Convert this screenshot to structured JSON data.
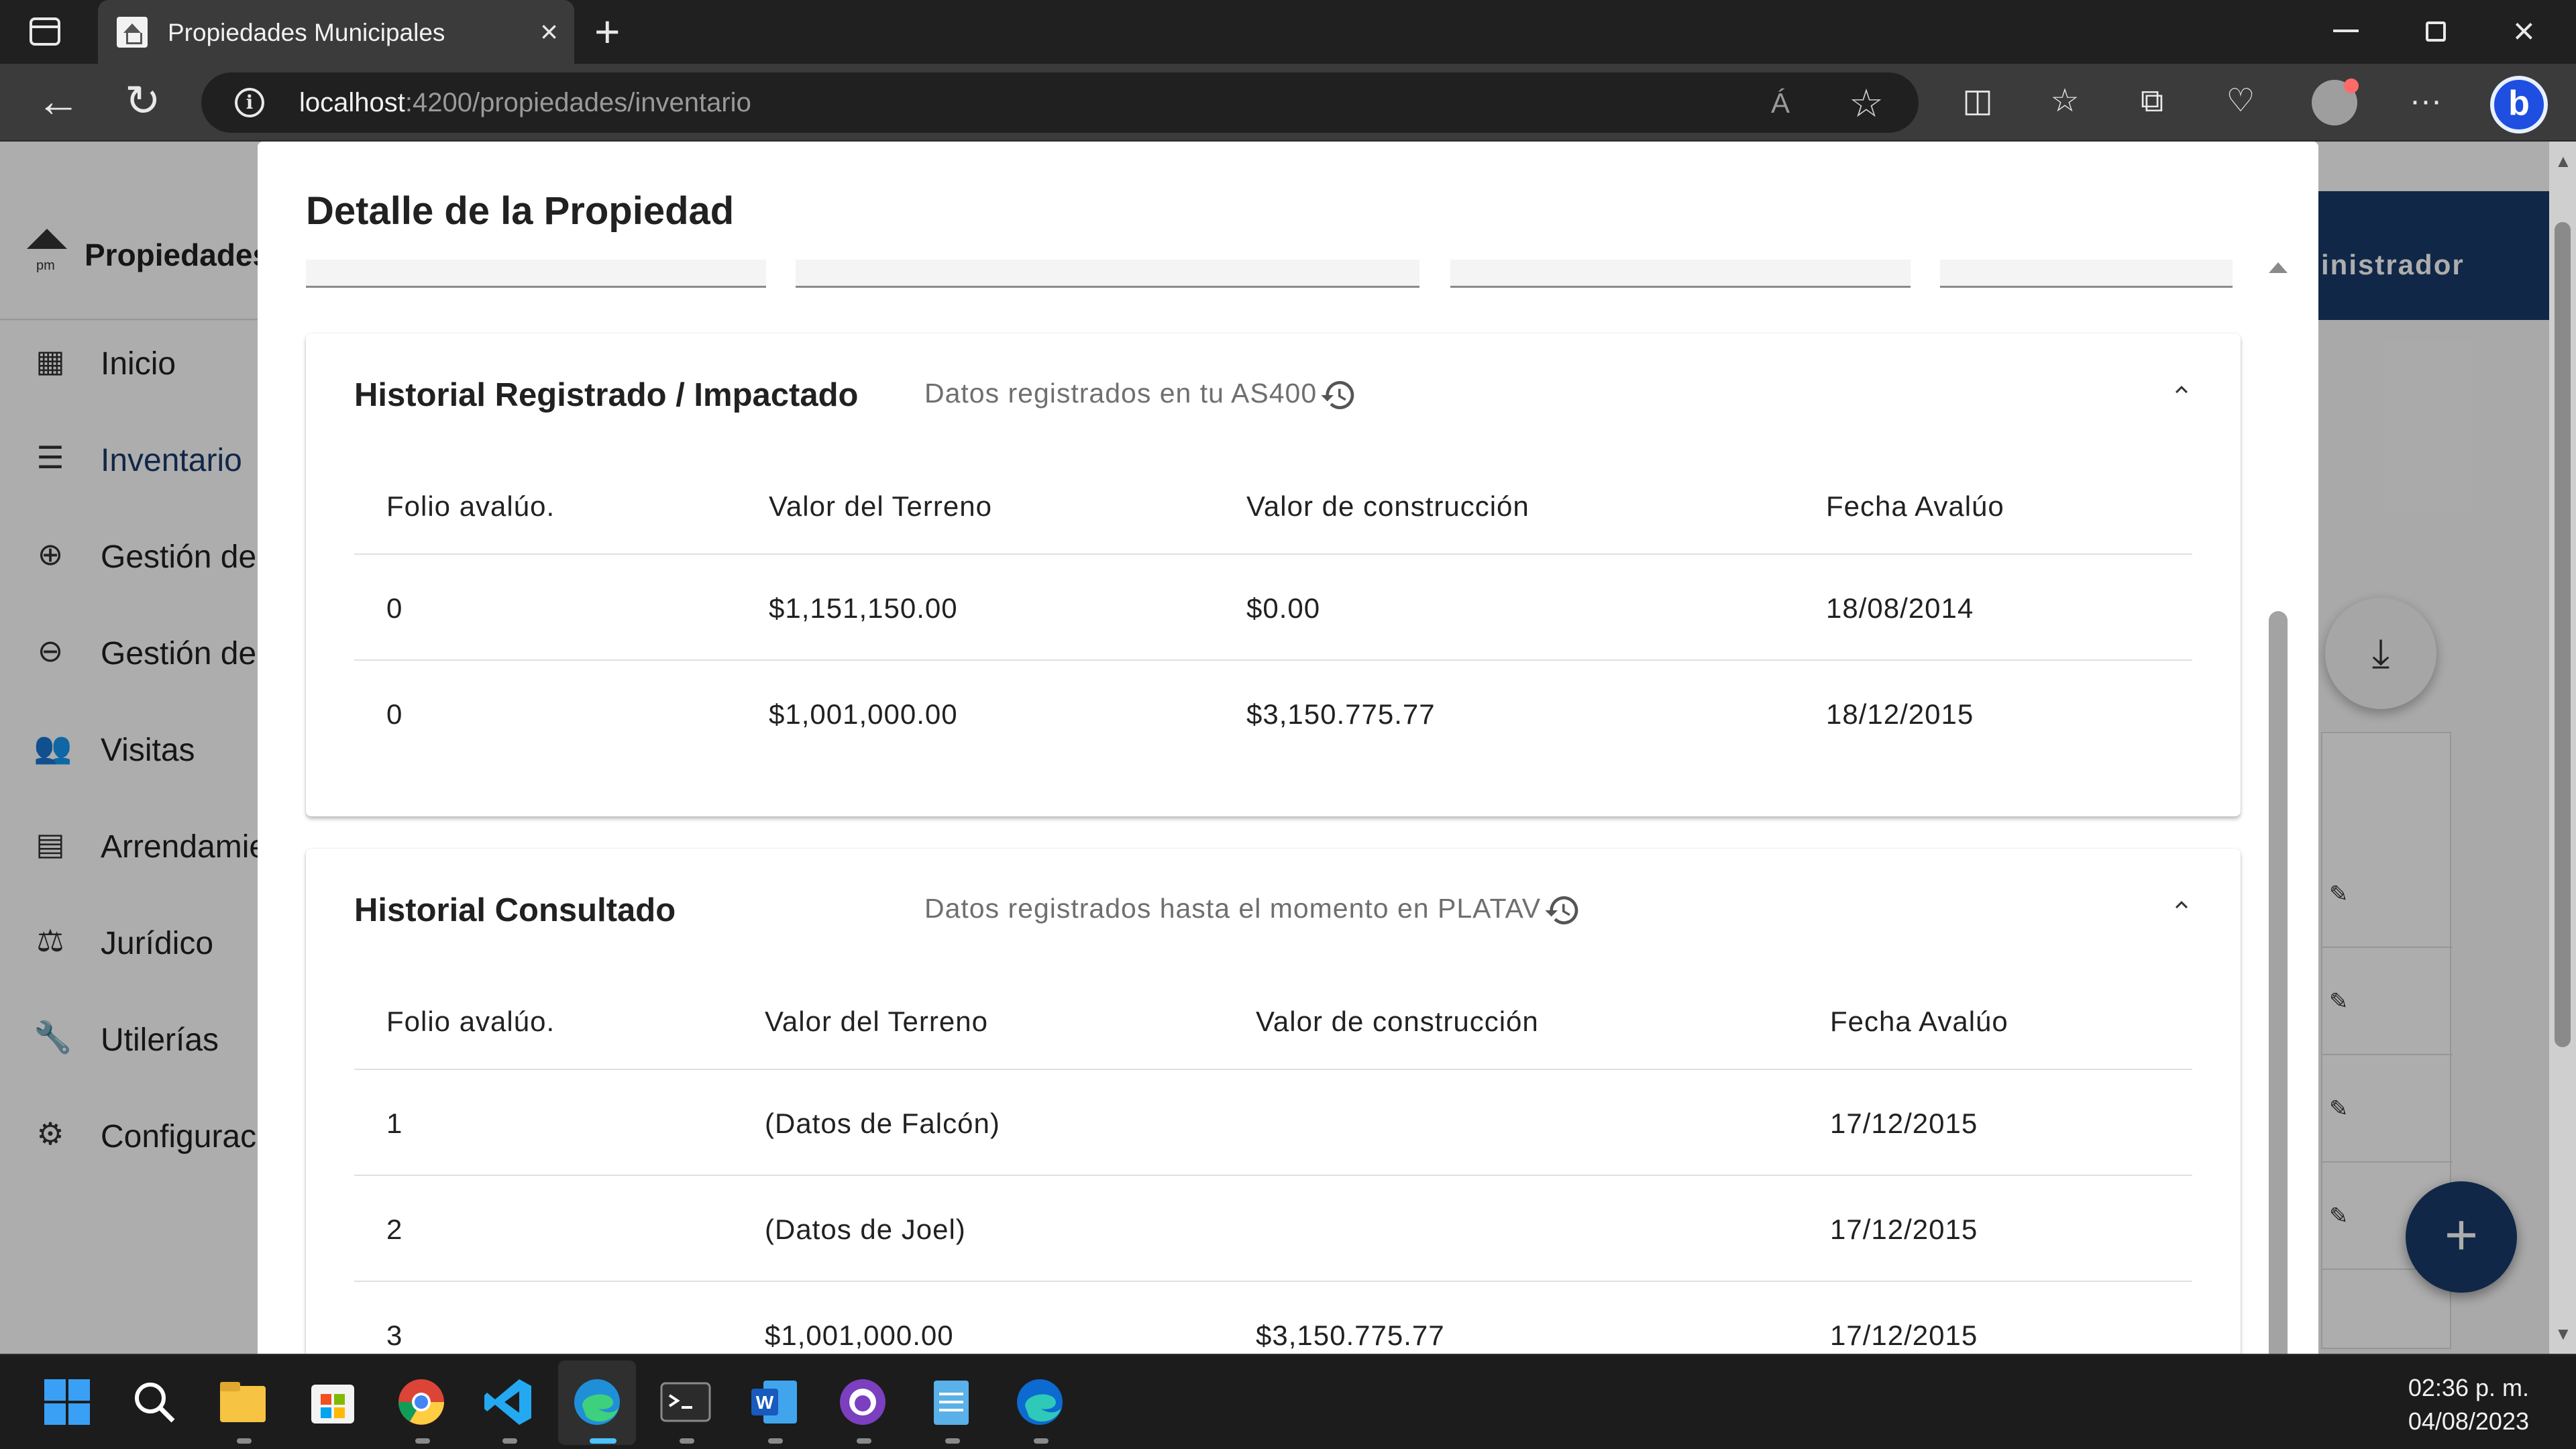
{
  "browser": {
    "tab_title": "Propiedades Municipales",
    "url_host": "localhost",
    "url_path": ":4200/propiedades/inventario",
    "read_aloud_glyph": "Á",
    "icons": [
      "sidebar-toggle-icon",
      "close-icon",
      "new-tab-icon",
      "back-icon",
      "reload-icon",
      "info-icon",
      "read-aloud-icon",
      "favorite-star-icon",
      "split-screen-icon",
      "favorites-icon",
      "collections-icon",
      "browser-essentials-icon",
      "profile-icon",
      "more-icon",
      "bing-copilot-icon"
    ]
  },
  "app": {
    "brand": "Propiedades",
    "admin_label": "inistrador",
    "sidebar": [
      {
        "label": "Inicio",
        "icon": "dashboard-icon"
      },
      {
        "label": "Inventario",
        "icon": "list-icon",
        "active": true
      },
      {
        "label": "Gestión de",
        "icon": "add-circle-icon"
      },
      {
        "label": "Gestión de",
        "icon": "remove-circle-icon"
      },
      {
        "label": "Visitas",
        "icon": "people-icon"
      },
      {
        "label": "Arrendamie",
        "icon": "store-icon"
      },
      {
        "label": "Jurídico",
        "icon": "gavel-icon"
      },
      {
        "label": "Utilerías",
        "icon": "wrench-icon"
      },
      {
        "label": "Configurac",
        "icon": "gear-icon"
      }
    ],
    "download_label": "⤓",
    "add_label": "+"
  },
  "dialog": {
    "title": "Detalle de la Propiedad",
    "registered": {
      "title": "Historial Registrado / Impactado",
      "subtitle": "Datos registrados en tu AS400",
      "columns": [
        "Folio avalúo.",
        "Valor del Terreno",
        "Valor de construcción",
        "Fecha Avalúo"
      ],
      "rows": [
        [
          "0",
          "$1,151,150.00",
          "$0.00",
          "18/08/2014"
        ],
        [
          "0",
          "$1,001,000.00",
          "$3,150.775.77",
          "18/12/2015"
        ]
      ]
    },
    "consulted": {
      "title": "Historial Consultado",
      "subtitle": "Datos registrados hasta el momento en PLATAV",
      "columns": [
        "Folio avalúo.",
        "Valor del Terreno",
        "Valor de construcción",
        "Fecha Avalúo"
      ],
      "rows": [
        [
          "1",
          "(Datos de Falcón)",
          "",
          "17/12/2015"
        ],
        [
          "2",
          "(Datos de Joel)",
          "",
          "17/12/2015"
        ],
        [
          "3",
          "$1,001,000.00",
          "$3,150.775.77",
          "17/12/2015"
        ]
      ]
    }
  },
  "taskbar": {
    "apps": [
      "windows-start-icon",
      "search-icon",
      "file-explorer-icon",
      "microsoft-store-icon",
      "chrome-icon",
      "vscode-icon",
      "edge-icon",
      "terminal-icon",
      "word-icon",
      "github-desktop-icon",
      "notepad-icon",
      "edge-alt-icon"
    ],
    "time": "02:36 p. m.",
    "date": "04/08/2023"
  }
}
